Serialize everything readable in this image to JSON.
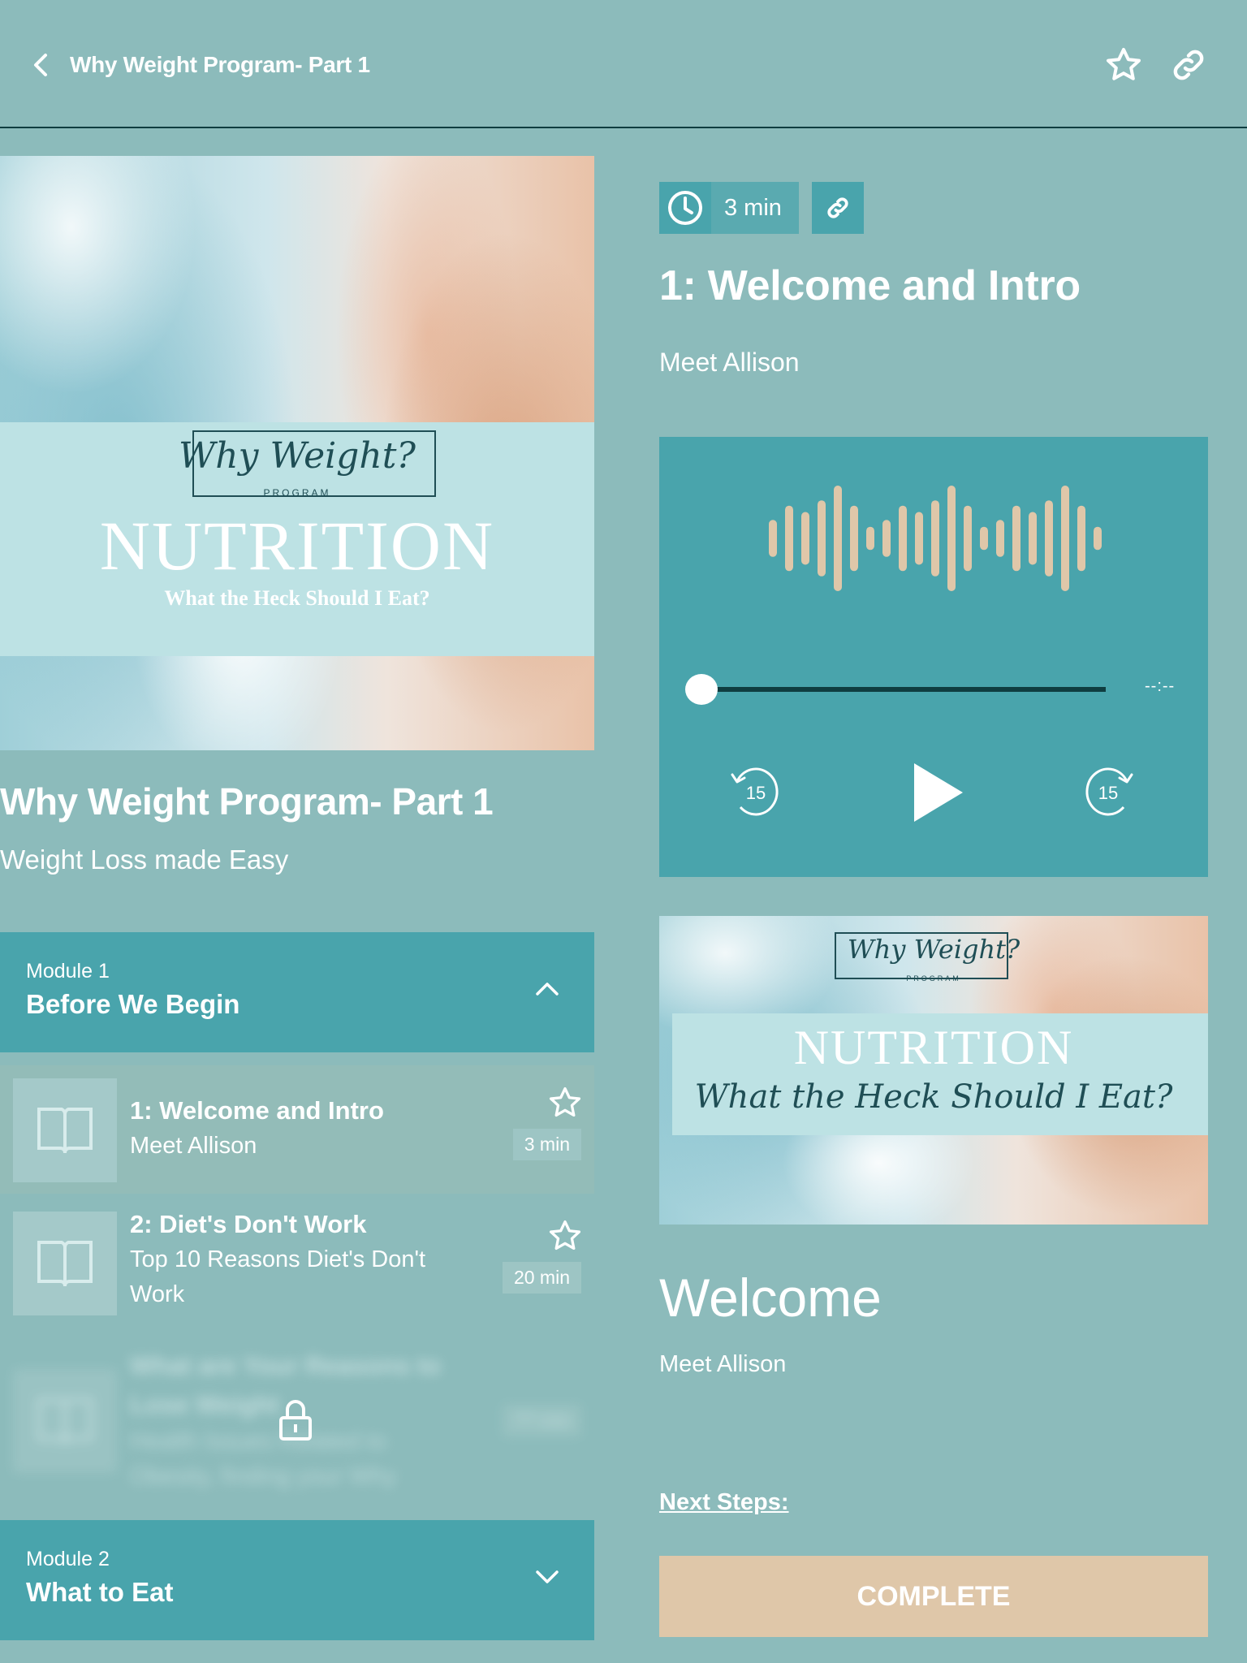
{
  "header": {
    "title": "Why Weight Program- Part 1",
    "back_icon": "chevron-left-icon",
    "favorite_icon": "star-outline-icon",
    "share_icon": "link-icon"
  },
  "program": {
    "cover": {
      "logo_script": "Why Weight?",
      "logo_sub": "PROGRAM",
      "headline": "NUTRITION",
      "tagline": "What the Heck Should I Eat?"
    },
    "title": "Why Weight Program- Part 1",
    "subtitle": "Weight Loss made Easy"
  },
  "modules": [
    {
      "label": "Module 1",
      "title": "Before We Begin",
      "expanded": true,
      "lessons": [
        {
          "title": "1: Welcome and Intro",
          "subtitle": "Meet Allison",
          "duration": "3 min",
          "active": true,
          "locked": false
        },
        {
          "title": "2: Diet's Don't Work",
          "subtitle": "Top 10 Reasons Diet's Don't Work",
          "duration": "20 min",
          "active": false,
          "locked": false
        },
        {
          "title": "What are Your Reasons to Lose Weight",
          "subtitle": "Health Issues Related to Obesity, finding your Why",
          "duration": "?? min",
          "active": false,
          "locked": true
        }
      ]
    },
    {
      "label": "Module 2",
      "title": "What to Eat",
      "expanded": false
    }
  ],
  "lesson": {
    "duration": "3 min",
    "title": "1: Welcome and Intro",
    "subtitle": "Meet Allison",
    "player": {
      "progress": 0,
      "time_remaining": "--:--",
      "rewind_seconds": "15",
      "forward_seconds": "15",
      "waveform_levels": [
        0.35,
        0.62,
        0.5,
        0.72,
        1.0,
        0.62,
        0.22,
        0.35,
        0.62,
        0.5,
        0.72,
        1.0,
        0.62,
        0.22,
        0.35,
        0.62,
        0.5,
        0.72,
        1.0,
        0.62,
        0.22
      ]
    },
    "image": {
      "logo_script": "Why Weight?",
      "logo_sub": "PROGRAM",
      "headline": "NUTRITION",
      "tagline": "What the Heck Should I Eat?"
    },
    "body_heading": "Welcome",
    "body_text": "Meet Allison",
    "next_steps_label": "Next Steps:",
    "complete_label": "COMPLETE"
  },
  "colors": {
    "background": "#8cbbbb",
    "accent": "#49a4ac",
    "divider": "#0f3d40",
    "waveform": "#dfc7a9",
    "complete_button": "#dfc7a9"
  }
}
